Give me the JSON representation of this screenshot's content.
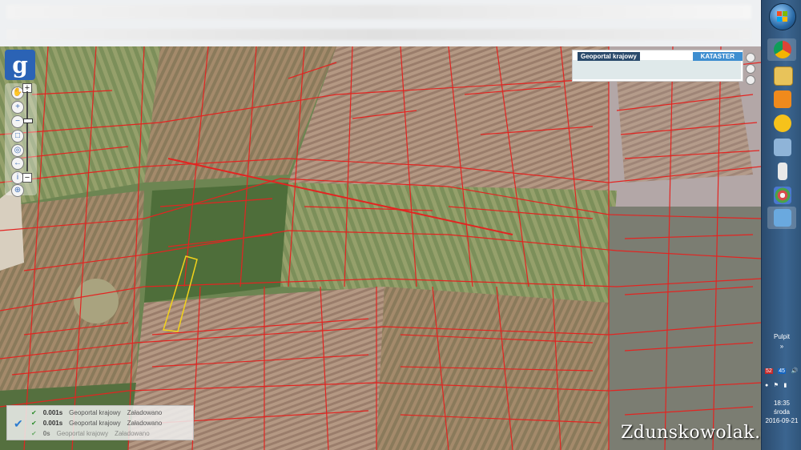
{
  "map": {
    "service": "Geoportal krajowy",
    "layer_tab": "KATASTER",
    "logo_letter": "g",
    "zoom_in": "+",
    "zoom_out": "−",
    "status": [
      {
        "time": "0.001s",
        "service": "Geoportal krajowy",
        "state": "Załadowano"
      },
      {
        "time": "0.001s",
        "service": "Geoportal krajowy",
        "state": "Załadowano"
      },
      {
        "time": "0s",
        "service": "Geoportal krajowy",
        "state": "Załadowano"
      }
    ],
    "watermark": "Zdunskowolak.pl"
  },
  "taskbar": {
    "desktop_label": "Pulpit",
    "tray_numbers": [
      "52",
      "45"
    ],
    "clock_time": "18:35",
    "clock_day": "środa",
    "clock_date": "2016-09-21"
  },
  "colors": {
    "parcel_line": "#e32421",
    "selected_parcel": "#f2d21a",
    "accent": "#3e8ed0"
  }
}
